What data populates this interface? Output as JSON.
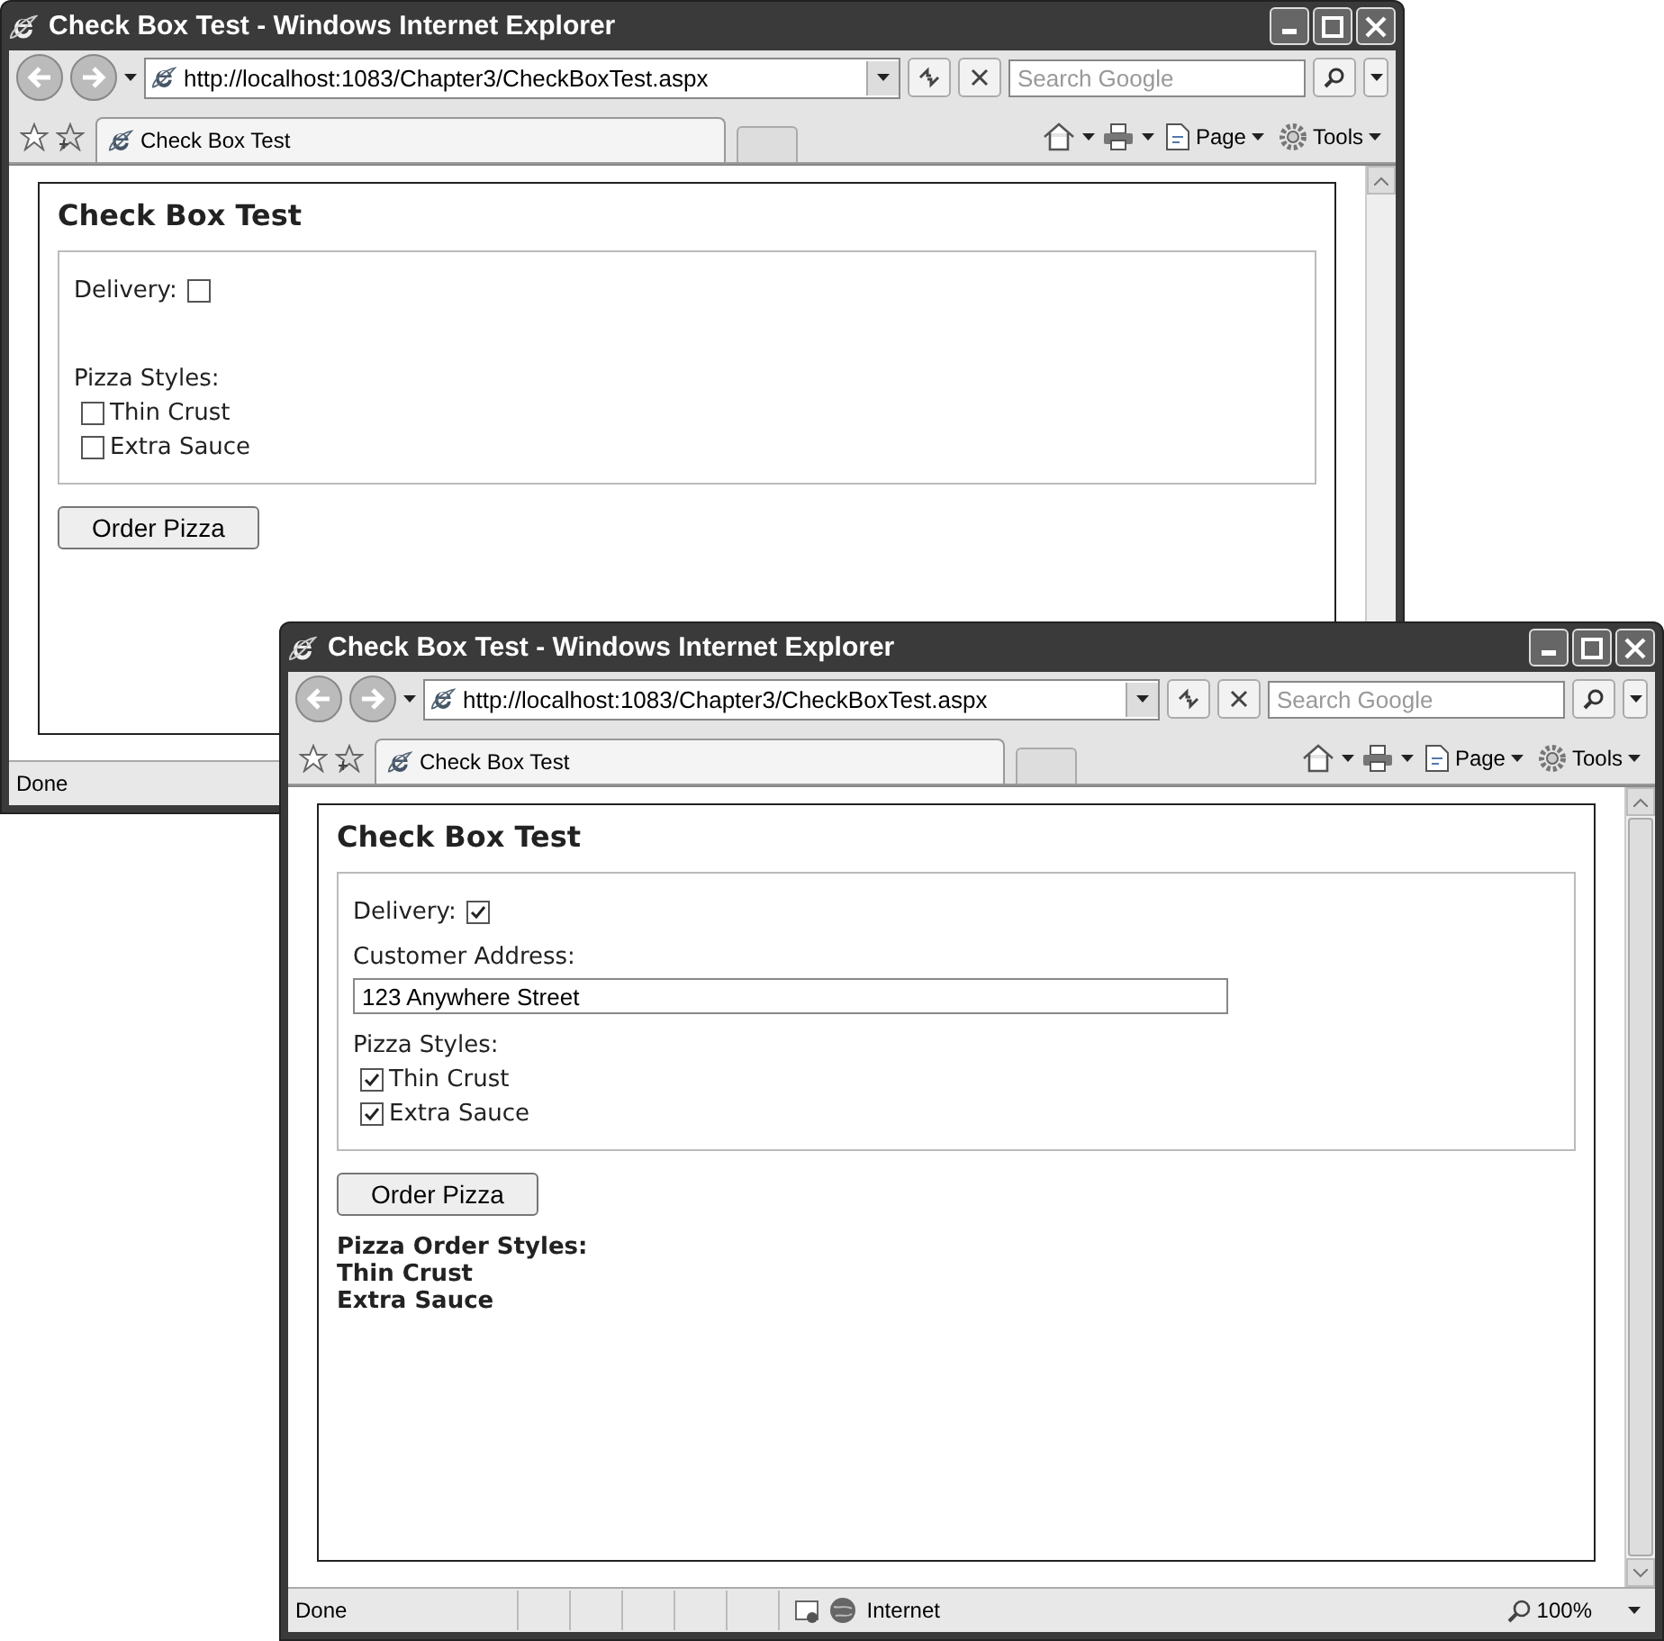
{
  "windows": [
    {
      "title": "Check Box Test - Windows Internet Explorer",
      "address": "http://localhost:1083/Chapter3/CheckBoxTest.aspx",
      "search_placeholder": "Search Google",
      "tab_title": "Check Box Test",
      "menus": [
        "Page",
        "Tools"
      ],
      "form": {
        "heading": "Check Box Test",
        "delivery_label": "Delivery:",
        "delivery_checked": false,
        "styles_label": "Pizza Styles:",
        "styles": [
          {
            "label": "Thin Crust",
            "checked": false
          },
          {
            "label": "Extra Sauce",
            "checked": false
          }
        ],
        "button": "Order Pizza"
      },
      "status": {
        "text": "Done"
      }
    },
    {
      "title": "Check Box Test - Windows Internet Explorer",
      "address": "http://localhost:1083/Chapter3/CheckBoxTest.aspx",
      "search_placeholder": "Search Google",
      "tab_title": "Check Box Test",
      "menus": [
        "Page",
        "Tools"
      ],
      "form": {
        "heading": "Check Box Test",
        "delivery_label": "Delivery:",
        "delivery_checked": true,
        "address_label": "Customer Address:",
        "address_value": "123 Anywhere Street",
        "styles_label": "Pizza Styles:",
        "styles": [
          {
            "label": "Thin Crust",
            "checked": true
          },
          {
            "label": "Extra Sauce",
            "checked": true
          }
        ],
        "button": "Order Pizza",
        "output": [
          "Pizza Order Styles:",
          "Thin Crust",
          "Extra Sauce"
        ]
      },
      "status": {
        "text": "Done",
        "zone": "Internet",
        "zoom": "100%"
      }
    }
  ]
}
